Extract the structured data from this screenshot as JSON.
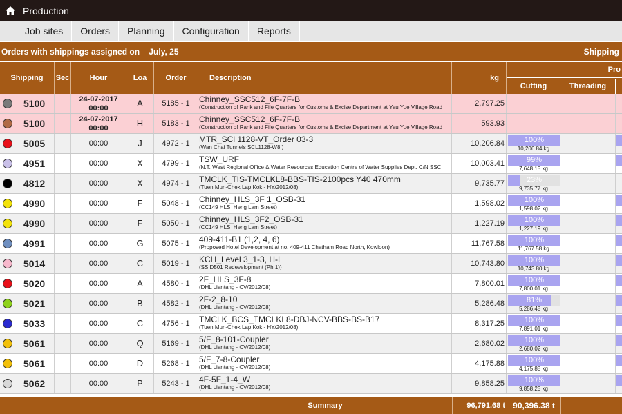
{
  "app": {
    "title": "Production"
  },
  "menu": [
    "Job sites",
    "Orders",
    "Planning",
    "Configuration",
    "Reports"
  ],
  "header": {
    "orders_title": "Orders with shippings assigned on",
    "date": "July, 25",
    "shipping_title": "Shipping",
    "process_title": "Pro",
    "columns": {
      "shipping": "Shipping",
      "sec": "Sec",
      "hour": "Hour",
      "loa": "Loa",
      "order": "Order",
      "description": "Description",
      "kg": "kg",
      "cutting": "Cutting",
      "threading": "Threading"
    }
  },
  "rows": [
    {
      "color": "#7a7a7a",
      "shipping": "5100",
      "date": "24-07-2017",
      "hour": "00:00",
      "loa": "A",
      "order": "5185 - 1",
      "desc": "Chinney_SSC512_6F-7F-B",
      "desc_sub": "(Construction of Rank and File Quarters for Customs & Excise Department at Yau Yue Village Road",
      "kg": "2,797.25",
      "highlight": true
    },
    {
      "color": "#b06a45",
      "shipping": "5100",
      "date": "24-07-2017",
      "hour": "00:00",
      "loa": "H",
      "order": "5183 - 1",
      "desc": "Chinney_SSC512_6F-7F-B",
      "desc_sub": "(Construction of Rank and File Quarters for Customs & Excise Department at Yau Yue Village Road",
      "kg": "593.93",
      "highlight": true
    },
    {
      "color": "#e8101a",
      "shipping": "5005",
      "hour": "00:00",
      "loa": "J",
      "order": "4972 - 1",
      "desc": "MTR_SCl 1128-VT_Order 03-3",
      "desc_sub": "(Wan Chai Tunnels SCL1128-W8 )",
      "kg": "10,206.84",
      "cut_pct": "100%",
      "cut_frac": 1.0,
      "cut_kg": "10,206.84 kg",
      "rest": true
    },
    {
      "color": "#c9c0e8",
      "shipping": "4951",
      "hour": "00:00",
      "loa": "X",
      "order": "4799 - 1",
      "desc": "TSW_URF",
      "desc_sub": "(N.T. West Regional Office & Water Resources Education Centre of Water Supplies Dept. C/N SSC",
      "kg": "10,003.41",
      "cut_pct": "99%",
      "cut_frac": 0.99,
      "cut_kg": "7,648.15 kg",
      "rest": true
    },
    {
      "color": "#000000",
      "shipping": "4812",
      "hour": "00:00",
      "loa": "X",
      "order": "4974 - 1",
      "desc": "TMCLK_TIS-TMCLKL8-BBS-TIS-2100pcs Y40 470mm",
      "desc_sub": "(Tuen Mun-Chek Lap Kok - HY/2012/08)",
      "kg": "9,735.77",
      "cut_pct": "23%",
      "cut_frac": 0.23,
      "cut_kg": "9,735.77 kg",
      "rest": false
    },
    {
      "color": "#f2e20a",
      "shipping": "4990",
      "hour": "00:00",
      "loa": "F",
      "order": "5048 - 1",
      "desc": "Chinney_HLS_3F 1_OSB-31",
      "desc_sub": "(CC149 HLS_Heng Lam Street)",
      "kg": "1,598.02",
      "cut_pct": "100%",
      "cut_frac": 1.0,
      "cut_kg": "1,598.02 kg",
      "rest": true
    },
    {
      "color": "#f2e20a",
      "shipping": "4990",
      "hour": "00:00",
      "loa": "F",
      "order": "5050 - 1",
      "desc": "Chinney_HLS_3F2_OSB-31",
      "desc_sub": "(CC149 HLS_Heng Lam Street)",
      "kg": "1,227.19",
      "cut_pct": "100%",
      "cut_frac": 1.0,
      "cut_kg": "1,227.19 kg",
      "rest": true
    },
    {
      "color": "#6f8fc0",
      "shipping": "4991",
      "hour": "00:00",
      "loa": "G",
      "order": "5075 - 1",
      "desc": "409-411-B1 (1,2, 4, 6)",
      "desc_sub": "(Proposed Hotel Development at no. 409-411 Chatham Road North, Kowloon)",
      "kg": "11,767.58",
      "cut_pct": "100%",
      "cut_frac": 1.0,
      "cut_kg": "11,767.58 kg",
      "rest": true
    },
    {
      "color": "#f7b8cc",
      "shipping": "5014",
      "hour": "00:00",
      "loa": "C",
      "order": "5019 - 1",
      "desc": "KCH_Level 3_1-3, H-L",
      "desc_sub": "(SS D501 Redevelopment (Ph 1))",
      "kg": "10,743.80",
      "cut_pct": "100%",
      "cut_frac": 1.0,
      "cut_kg": "10,743.80 kg",
      "rest": true
    },
    {
      "color": "#e8101a",
      "shipping": "5020",
      "hour": "00:00",
      "loa": "A",
      "order": "4580 - 1",
      "desc": "2F_HLS_3F-8",
      "desc_sub": "(DHL Liantang - CV/2012/08)",
      "kg": "7,800.01",
      "cut_pct": "100%",
      "cut_frac": 1.0,
      "cut_kg": "7,800.01 kg",
      "rest": true
    },
    {
      "color": "#8fd21a",
      "shipping": "5021",
      "hour": "00:00",
      "loa": "B",
      "order": "4582 - 1",
      "desc": "2F-2_8-10",
      "desc_sub": "(DHL Liantang - CV/2012/08)",
      "kg": "5,286.48",
      "cut_pct": "81%",
      "cut_frac": 0.81,
      "cut_kg": "5,286.48 kg",
      "rest": true
    },
    {
      "color": "#2a2ad0",
      "shipping": "5033",
      "hour": "00:00",
      "loa": "C",
      "order": "4756 - 1",
      "desc": "TMCLK_BCS_TMCLKL8-DBJ-NCV-BBS-BS-B17",
      "desc_sub": "(Tuen Mun-Chek Lap Kok - HY/2012/08)",
      "kg": "8,317.25",
      "cut_pct": "100%",
      "cut_frac": 1.0,
      "cut_kg": "7,891.01 kg",
      "rest": true
    },
    {
      "color": "#f2c00a",
      "shipping": "5061",
      "hour": "00:00",
      "loa": "Q",
      "order": "5169 - 1",
      "desc": "5/F_8-101-Coupler",
      "desc_sub": "(DHL Liantang - CV/2012/08)",
      "kg": "2,680.02",
      "cut_pct": "100%",
      "cut_frac": 1.0,
      "cut_kg": "2,680.02 kg",
      "rest": true
    },
    {
      "color": "#f2c00a",
      "shipping": "5061",
      "hour": "00:00",
      "loa": "D",
      "order": "5268 - 1",
      "desc": "5/F_7-8-Coupler",
      "desc_sub": "(DHL Liantang - CV/2012/08)",
      "kg": "4,175.88",
      "cut_pct": "100%",
      "cut_frac": 1.0,
      "cut_kg": "4,175.88 kg",
      "rest": true
    },
    {
      "color": "#d8d8d8",
      "shipping": "5062",
      "hour": "00:00",
      "loa": "P",
      "order": "5243 - 1",
      "desc": "4F-5F_1-4_W",
      "desc_sub": "(DHL Liantang - CV/2012/08)",
      "kg": "9,858.25",
      "cut_pct": "100%",
      "cut_frac": 1.0,
      "cut_kg": "9,858.25 kg",
      "rest": true
    }
  ],
  "summary": {
    "label": "Summary",
    "kg": "96,791.68 t",
    "cutting": "90,396.38 t"
  },
  "colors": {
    "header": "#a55a16",
    "topbar": "#231816",
    "progress": "#a9a4f0",
    "highlight_row": "#fbd0d4"
  }
}
